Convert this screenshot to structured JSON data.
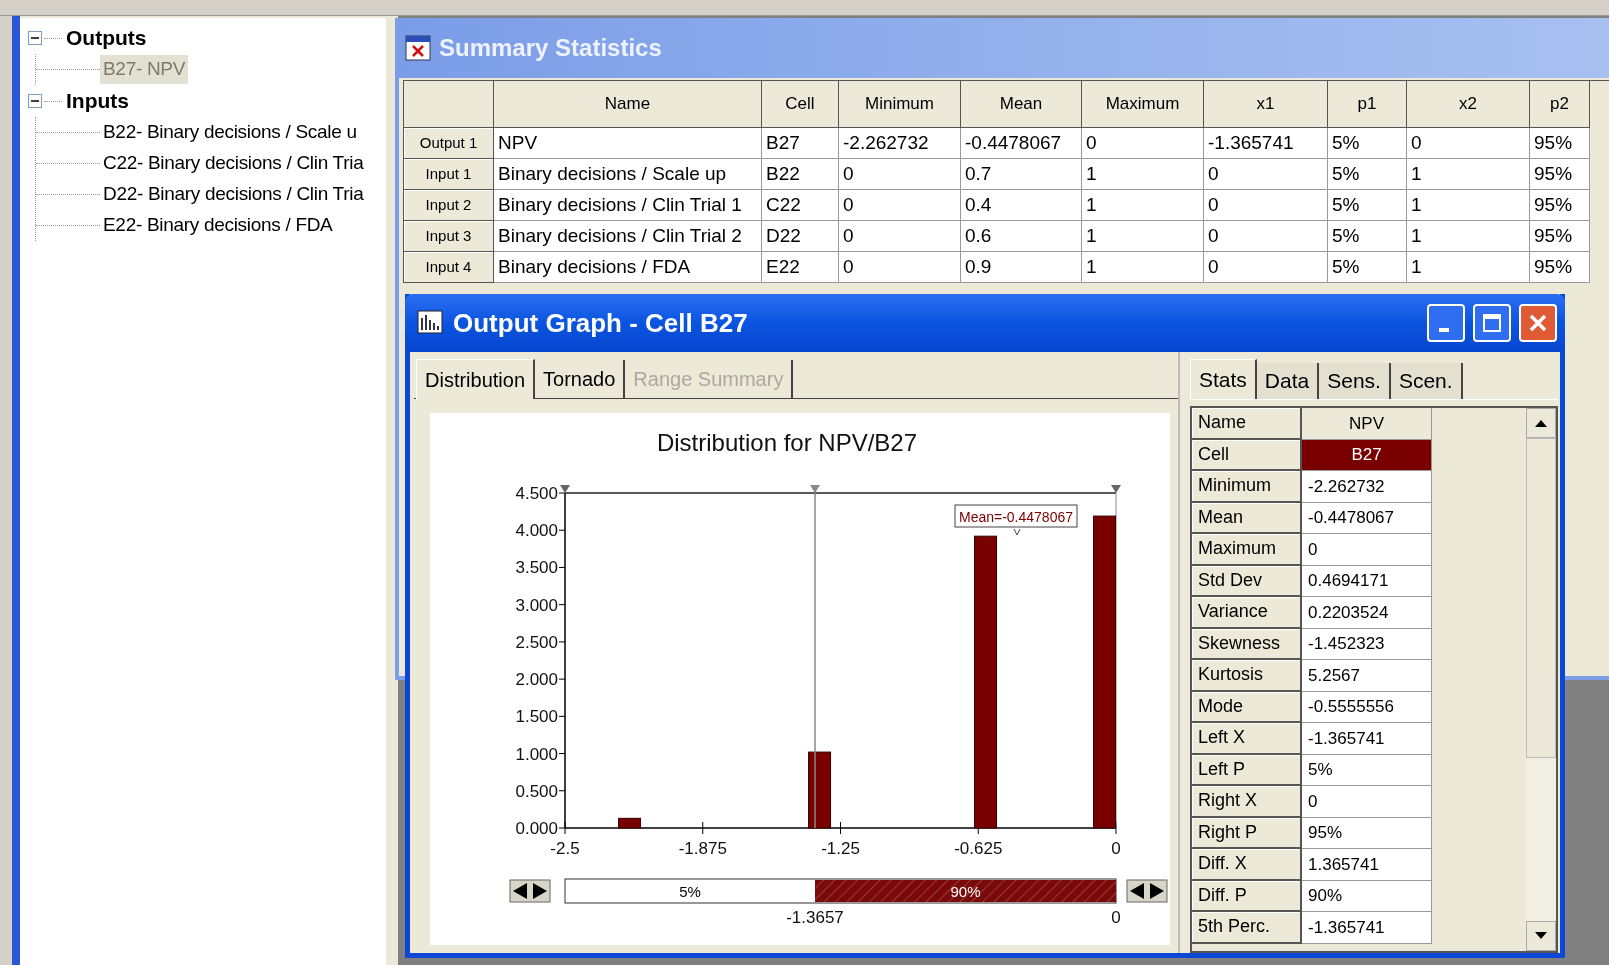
{
  "tree": [
    {
      "label": "Outputs",
      "expanded": true,
      "selected": false,
      "children": [
        {
          "label": "B27- NPV",
          "selected": true
        }
      ]
    },
    {
      "label": "Inputs",
      "expanded": true,
      "selected": false,
      "children": [
        {
          "label": "B22- Binary decisions / Scale u",
          "selected": false
        },
        {
          "label": "C22- Binary decisions / Clin Tria",
          "selected": false
        },
        {
          "label": "D22- Binary decisions / Clin Tria",
          "selected": false
        },
        {
          "label": "E22- Binary decisions / FDA",
          "selected": false
        }
      ]
    }
  ],
  "summary_window": {
    "title": "Summary Statistics",
    "columns": [
      "Name",
      "Cell",
      "Minimum",
      "Mean",
      "Maximum",
      "x1",
      "p1",
      "x2",
      "p2"
    ],
    "rows": [
      {
        "header": "Output 1",
        "cells": [
          "NPV",
          "B27",
          "-2.262732",
          "-0.4478067",
          "0",
          "-1.365741",
          "5%",
          "0",
          "95%"
        ]
      },
      {
        "header": "Input 1",
        "cells": [
          "Binary decisions / Scale up",
          "B22",
          "0",
          "0.7",
          "1",
          "0",
          "5%",
          "1",
          "95%"
        ]
      },
      {
        "header": "Input 2",
        "cells": [
          "Binary decisions / Clin Trial 1",
          "C22",
          "0",
          "0.4",
          "1",
          "0",
          "5%",
          "1",
          "95%"
        ]
      },
      {
        "header": "Input 3",
        "cells": [
          "Binary decisions / Clin Trial 2",
          "D22",
          "0",
          "0.6",
          "1",
          "0",
          "5%",
          "1",
          "95%"
        ]
      },
      {
        "header": "Input 4",
        "cells": [
          "Binary decisions / FDA",
          "E22",
          "0",
          "0.9",
          "1",
          "0",
          "5%",
          "1",
          "95%"
        ]
      }
    ]
  },
  "output_window": {
    "title": "Output Graph - Cell B27",
    "tabs": [
      {
        "label": "Distribution",
        "selected": true,
        "disabled": false
      },
      {
        "label": "Tornado",
        "selected": false,
        "disabled": false
      },
      {
        "label": "Range Summary",
        "selected": false,
        "disabled": true
      }
    ],
    "chart_data": {
      "type": "bar",
      "title": "Distribution for NPV/B27",
      "x": [
        -2.207,
        -1.345,
        -0.592,
        -0.052
      ],
      "values": [
        0.13,
        1.02,
        3.92,
        4.19
      ],
      "xlim": [
        -2.5,
        0
      ],
      "ylim": [
        0,
        4.5
      ],
      "xticks": [
        {
          "value": -2.5,
          "label": "-2.5"
        },
        {
          "value": -1.875,
          "label": "-1.875"
        },
        {
          "value": -1.25,
          "label": "-1.25"
        },
        {
          "value": -0.625,
          "label": "-0.625"
        },
        {
          "value": 0,
          "label": "0"
        }
      ],
      "yticks": [
        {
          "value": 0,
          "label": "0.000"
        },
        {
          "value": 0.5,
          "label": "0.500"
        },
        {
          "value": 1,
          "label": "1.000"
        },
        {
          "value": 1.5,
          "label": "1.500"
        },
        {
          "value": 2,
          "label": "2.000"
        },
        {
          "value": 2.5,
          "label": "2.500"
        },
        {
          "value": 3,
          "label": "3.000"
        },
        {
          "value": 3.5,
          "label": "3.500"
        },
        {
          "value": 4,
          "label": "4.000"
        },
        {
          "value": 4.5,
          "label": "4.500"
        }
      ],
      "ref_lines": [
        {
          "axis": "x",
          "value": -1.3657
        }
      ],
      "annotations": [
        "Mean=-0.4478067"
      ]
    },
    "range_bar": {
      "left_share": "5%",
      "middle_share": "90%",
      "left_value": "-1.3657",
      "right_value": "0"
    },
    "side_tabs": [
      {
        "label": "Stats",
        "selected": true
      },
      {
        "label": "Data",
        "selected": false
      },
      {
        "label": "Sens.",
        "selected": false
      },
      {
        "label": "Scen.",
        "selected": false
      }
    ],
    "stats": {
      "header": [
        "Name",
        "NPV"
      ],
      "rows": [
        {
          "label": "Cell",
          "value": "B27",
          "highlighted": true
        },
        {
          "label": "Minimum",
          "value": "-2.262732",
          "highlighted": false
        },
        {
          "label": "Mean",
          "value": "-0.4478067",
          "highlighted": false
        },
        {
          "label": "Maximum",
          "value": "0",
          "highlighted": false
        },
        {
          "label": "Std Dev",
          "value": "0.4694171",
          "highlighted": false
        },
        {
          "label": "Variance",
          "value": "0.2203524",
          "highlighted": false
        },
        {
          "label": "Skewness",
          "value": "-1.452323",
          "highlighted": false
        },
        {
          "label": "Kurtosis",
          "value": "5.2567",
          "highlighted": false
        },
        {
          "label": "Mode",
          "value": "-0.5555556",
          "highlighted": false
        },
        {
          "label": "Left X",
          "value": "-1.365741",
          "highlighted": false
        },
        {
          "label": "Left P",
          "value": "5%",
          "highlighted": false
        },
        {
          "label": "Right X",
          "value": "0",
          "highlighted": false
        },
        {
          "label": "Right P",
          "value": "95%",
          "highlighted": false
        },
        {
          "label": "Diff. X",
          "value": "1.365741",
          "highlighted": false
        },
        {
          "label": "Diff. P",
          "value": "90%",
          "highlighted": false
        },
        {
          "label": "5th Perc.",
          "value": "-1.365741",
          "highlighted": false
        }
      ]
    }
  }
}
